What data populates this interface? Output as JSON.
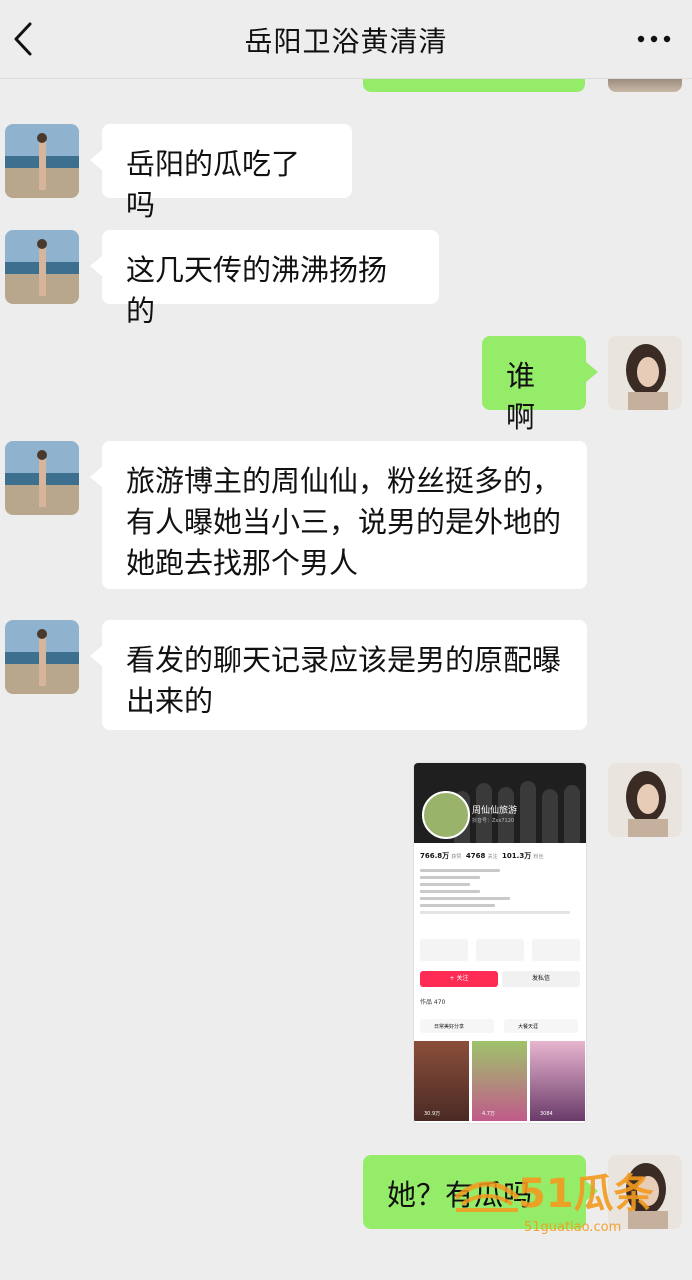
{
  "header": {
    "title": "岳阳卫浴黄清清"
  },
  "messages": [
    {
      "side": "in",
      "text": "岳阳的瓜吃了吗"
    },
    {
      "side": "in",
      "text": "这几天传的沸沸扬扬的"
    },
    {
      "side": "out",
      "text": "谁啊"
    },
    {
      "side": "in",
      "text": "旅游博主的周仙仙，粉丝挺多的，\n有人曝她当小三，说男的是外地的\n她跑去找那个男人"
    },
    {
      "side": "in",
      "text": "看发的聊天记录应该是男的原配曝\n出来的"
    },
    {
      "side": "out",
      "text": "她？有瓜吗"
    }
  ],
  "shared_screenshot": {
    "name": "周仙仙旅游",
    "account_id": "抖音号：Zxx7120",
    "likes": "766.8万",
    "likes_label": "获赞",
    "following": "4768",
    "following_label": "关注",
    "followers": "101.3万",
    "followers_label": "粉丝",
    "follow_button": "+ 关注",
    "message_button": "发私信",
    "works": "作品 470",
    "tab1": "日常美好分享",
    "tab2": "大餐天涯",
    "thumb_counts": [
      "30.9万",
      "4.7万",
      "3084"
    ]
  },
  "watermark": {
    "brand": "51瓜条",
    "url": "51guatiao.com"
  },
  "colors": {
    "incoming": "#ffffff",
    "outgoing": "#95ec69",
    "background": "#ededed"
  },
  "icons": [
    "back-arrow-icon",
    "more-dots-icon"
  ]
}
